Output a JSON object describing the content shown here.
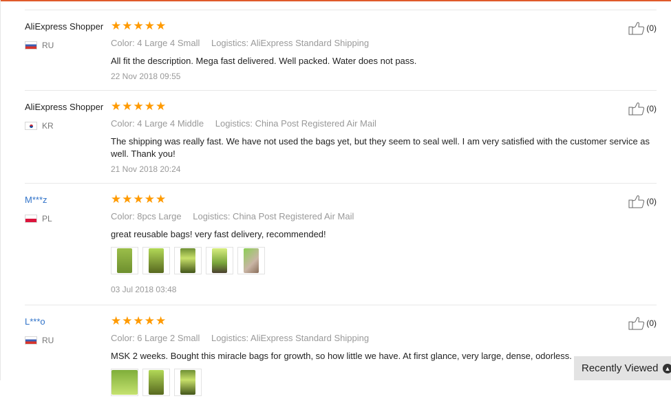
{
  "reviews": [
    {
      "buyer": "AliExpress Shopper",
      "country_code": "RU",
      "stars": "★★★★★",
      "color": "Color: 4 Large 4 Small",
      "logistics": "Logistics: AliExpress Standard Shipping",
      "text": "All fit the description. Mega fast delivered. Well packed. Water does not pass.",
      "date": "22 Nov 2018 09:55",
      "helpful_count": "(0)"
    },
    {
      "buyer": "AliExpress Shopper",
      "country_code": "KR",
      "stars": "★★★★★",
      "color": "Color: 4 Large 4 Middle",
      "logistics": "Logistics: China Post Registered Air Mail",
      "text": "The shipping was really fast. We have not used the bags yet, but they seem to seal well. I am very satisfied with the customer service as well. Thank you!",
      "date": "21 Nov 2018 20:24",
      "helpful_count": "(0)"
    },
    {
      "buyer": "M***z",
      "country_code": "PL",
      "stars": "★★★★★",
      "color": "Color: 8pcs Large",
      "logistics": "Logistics: China Post Registered Air Mail",
      "text": "great reusable bags! very fast delivery, recommended!",
      "date": "03 Jul 2018 03:48",
      "helpful_count": "(0)"
    },
    {
      "buyer": "L***o",
      "country_code": "RU",
      "stars": "★★★★★",
      "color": "Color: 6 Large 2 Small",
      "logistics": "Logistics: AliExpress Standard Shipping",
      "text": "MSK 2 weeks. Bought this miracle bags for growth, so how little we have. At first glance, very large, dense, odorless.",
      "helpful_count": "(0)"
    }
  ],
  "recently_viewed": {
    "label": "Recently Viewed",
    "icon": "chevron-up-circle-icon"
  },
  "colors": {
    "accent": "#e05a2b",
    "star": "#ff9a00",
    "link": "#3173c9",
    "muted": "#999999"
  }
}
